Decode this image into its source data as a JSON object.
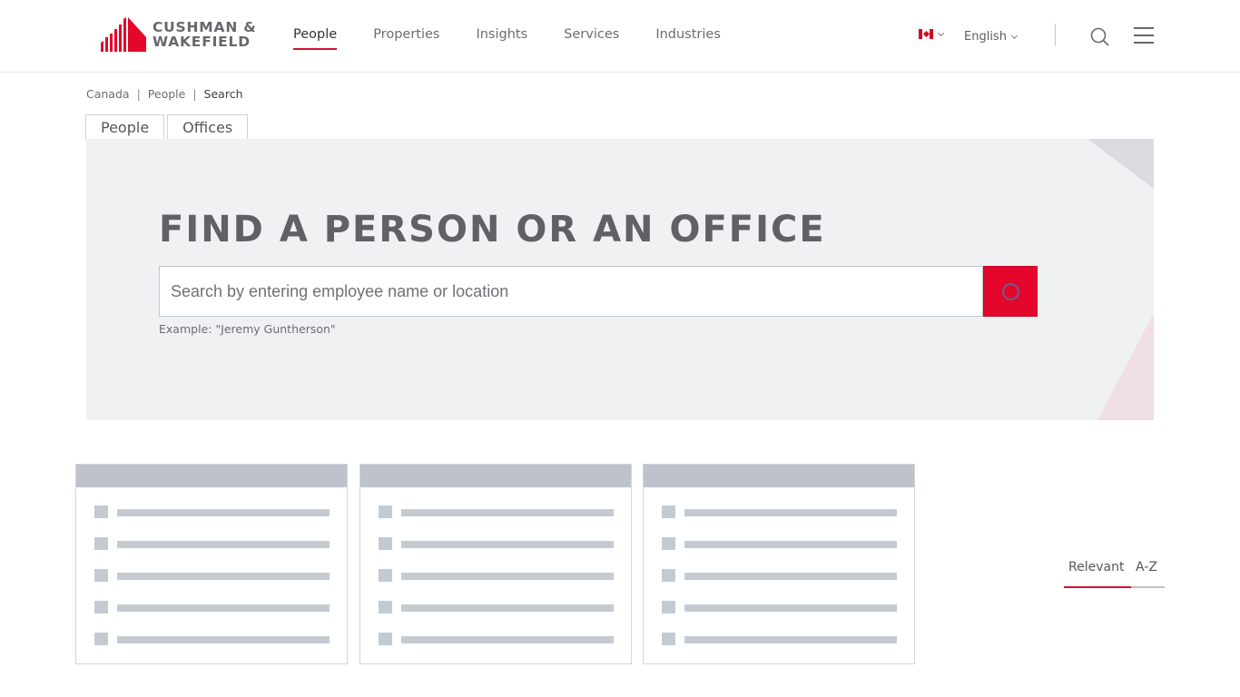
{
  "header": {
    "logo": {
      "line1": "CUSHMAN &",
      "line2": "WAKEFIELD",
      "brand_color": "#e4062b"
    },
    "nav": [
      {
        "label": "People",
        "active": true
      },
      {
        "label": "Properties",
        "active": false
      },
      {
        "label": "Insights",
        "active": false
      },
      {
        "label": "Services",
        "active": false
      },
      {
        "label": "Industries",
        "active": false
      }
    ],
    "country_flag": "canada-flag-icon",
    "language": "English",
    "search_icon": "search-icon",
    "menu_icon": "hamburger-menu-icon"
  },
  "breadcrumb": [
    "Canada",
    "People",
    "Search"
  ],
  "tabs": [
    {
      "label": "People"
    },
    {
      "label": "Offices"
    }
  ],
  "hero": {
    "title": "FIND A PERSON OR AN OFFICE",
    "search_placeholder": "Search by entering employee name or location",
    "search_value": "",
    "example": "Example: \"Jeremy Guntherson\"",
    "search_button_icon": "loading-spinner-icon",
    "accent_color": "#e4062b"
  },
  "results": {
    "state": "loading-skeleton",
    "cards": 3,
    "rows_per_card": 5
  },
  "sort": {
    "options": [
      "Relevant",
      "A-Z"
    ],
    "active": "Relevant"
  }
}
